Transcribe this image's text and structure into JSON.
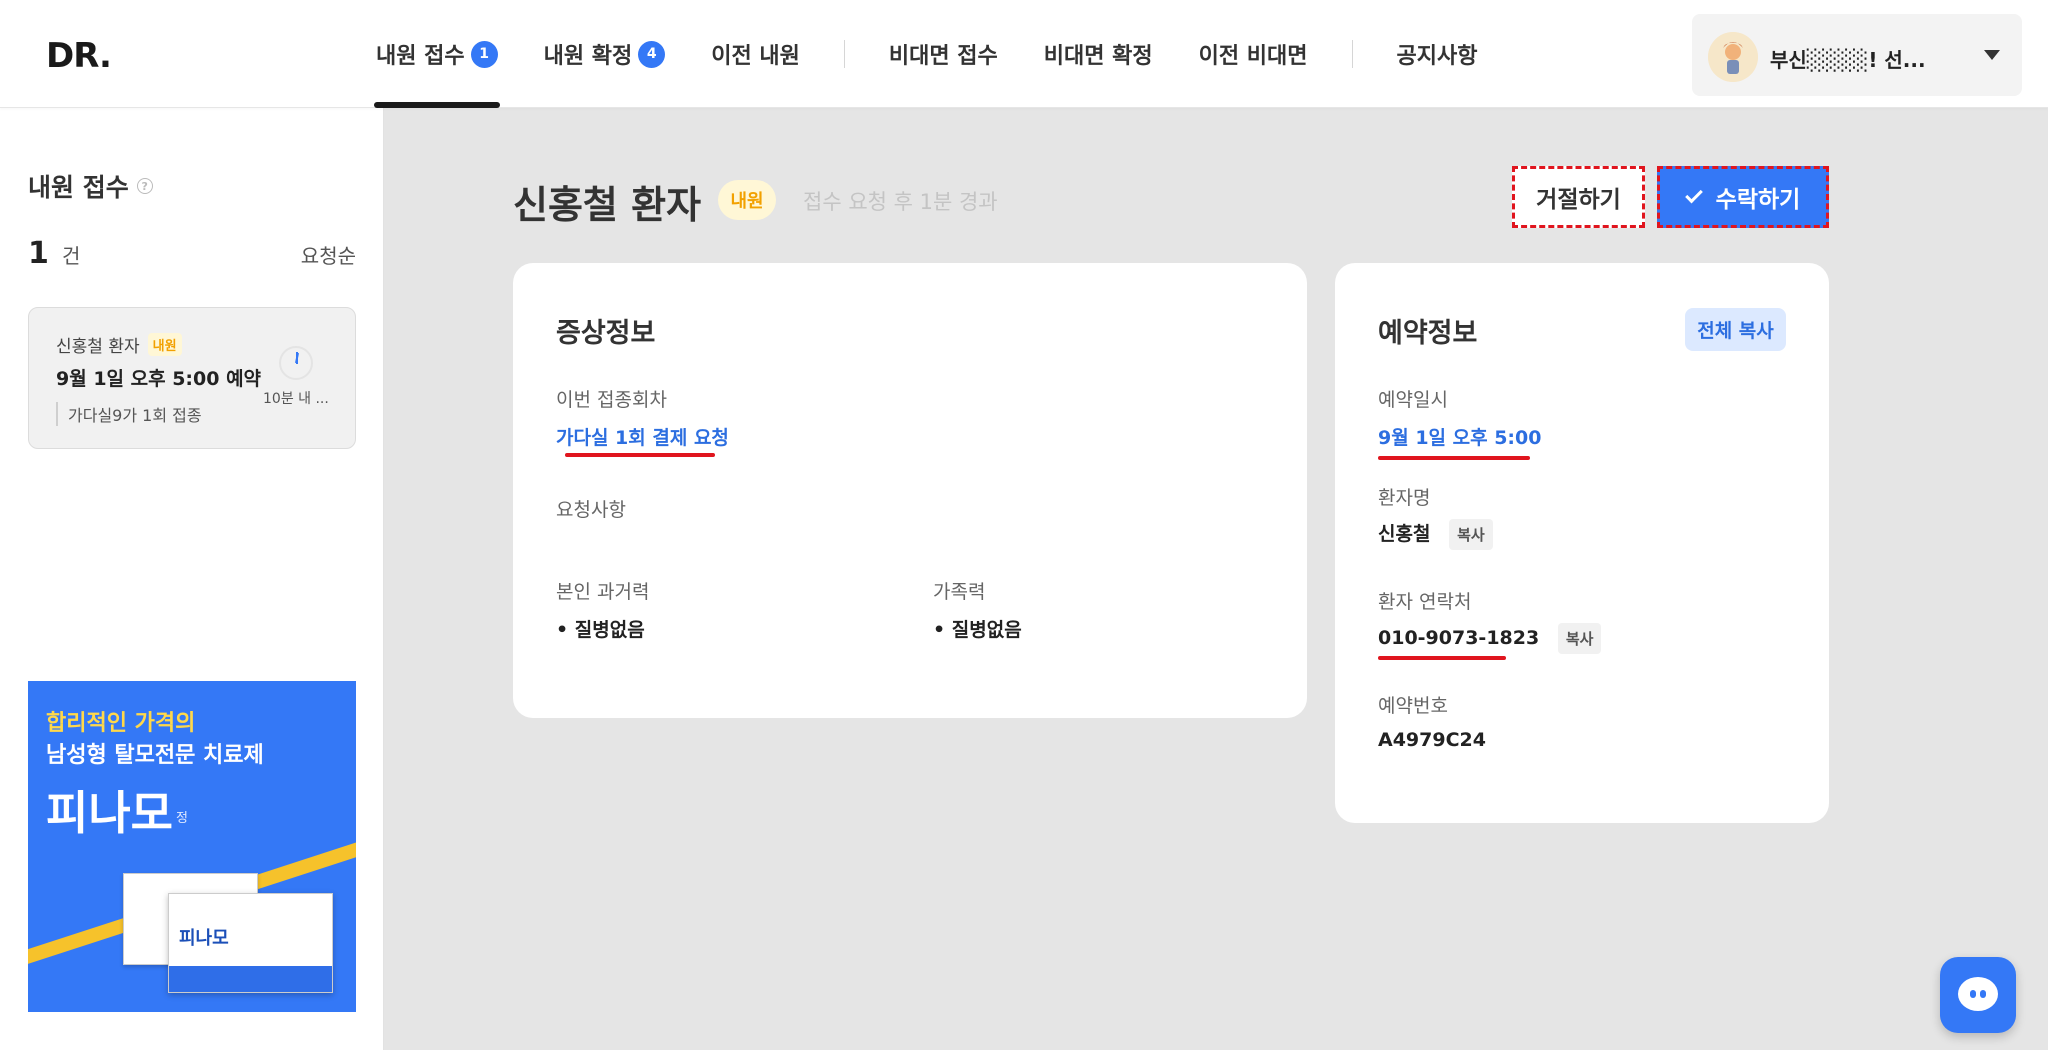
{
  "header": {
    "logo": "DR.",
    "tabs": [
      {
        "label": "내원 접수",
        "badge": "1"
      },
      {
        "label": "내원 확정",
        "badge": "4"
      },
      {
        "label": "이전 내원"
      },
      {
        "label": "비대면 접수"
      },
      {
        "label": "비대면 확정"
      },
      {
        "label": "이전 비대면"
      },
      {
        "label": "공지사항"
      }
    ],
    "user_name": "부신░░░░! 선..."
  },
  "sidebar": {
    "title": "내원 접수",
    "count": "1",
    "count_unit": "건",
    "sort_label": "요청순",
    "card": {
      "name": "신홍철 환자",
      "tag": "내원",
      "date": "9월 1일 오후 5:00 예약",
      "vaccine": "가다실9가 1회 접종",
      "elapsed": "10분 내 ..."
    },
    "ad": {
      "line1": "합리적인 가격의",
      "line2": "남성형 탈모전문 치료제",
      "brand": "피나모",
      "brand_sub": "정",
      "box_label": "피나모"
    }
  },
  "main": {
    "patient_title": "신홍철 환자",
    "visit_tag": "내원",
    "elapsed_text": "접수 요청 후 1분 경과",
    "reject_label": "거절하기",
    "accept_label": "수락하기"
  },
  "symptom": {
    "title": "증상정보",
    "dose_label": "이번 접종회차",
    "dose_value": "가다실 1회 결제 요청",
    "request_label": "요청사항",
    "history_label": "본인 과거력",
    "history_value": "• 질병없음",
    "family_label": "가족력",
    "family_value": "• 질병없음"
  },
  "reserve": {
    "title": "예약정보",
    "copy_all": "전체 복사",
    "datetime_label": "예약일시",
    "datetime_value": "9월 1일 오후 5:00",
    "name_label": "환자명",
    "name_value": "신홍철",
    "copy_label": "복사",
    "phone_label": "환자 연락처",
    "phone_value": "010-9073-1823",
    "number_label": "예약번호",
    "number_value": "A4979C24"
  },
  "colors": {
    "accent": "#3478f6",
    "highlight_red": "#e0151e",
    "tag_yellow": "#f2a100"
  }
}
